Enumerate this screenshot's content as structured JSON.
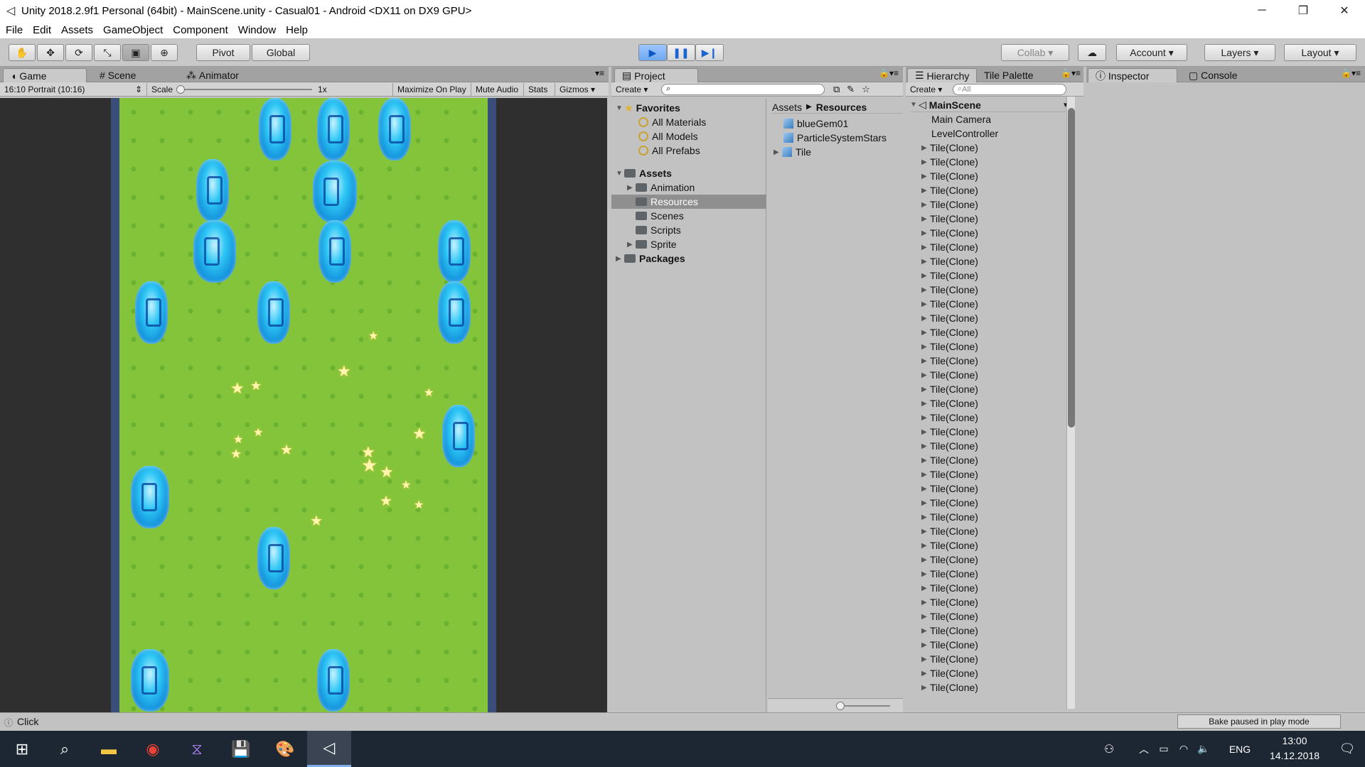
{
  "window": {
    "title": "Unity 2018.2.9f1 Personal (64bit) - MainScene.unity - Casual01 - Android <DX11 on DX9 GPU>",
    "minimize": "─",
    "restore": "❐",
    "close": "✕"
  },
  "menu": [
    "File",
    "Edit",
    "Assets",
    "GameObject",
    "Component",
    "Window",
    "Help"
  ],
  "toolbar": {
    "pivot": "Pivot",
    "global": "Global",
    "collab": "Collab",
    "account": "Account",
    "layers": "Layers",
    "layout": "Layout"
  },
  "game_panel": {
    "tabs": [
      "Game",
      "Scene",
      "Animator"
    ],
    "aspect": "16:10 Portrait (10:16)",
    "scale_label": "Scale",
    "scale_value": "1x",
    "maximize": "Maximize On Play",
    "mute": "Mute Audio",
    "stats": "Stats",
    "gizmos": "Gizmos"
  },
  "project_panel": {
    "tab": "Project",
    "create": "Create",
    "favorites": {
      "label": "Favorites",
      "items": [
        "All Materials",
        "All Models",
        "All Prefabs"
      ]
    },
    "assets": {
      "label": "Assets",
      "items": [
        "Animation",
        "Resources",
        "Scenes",
        "Scripts",
        "Sprite"
      ]
    },
    "packages": "Packages",
    "breadcrumb": [
      "Assets",
      "Resources"
    ],
    "files": [
      "blueGem01",
      "ParticleSystemStars",
      "Tile"
    ]
  },
  "hierarchy_panel": {
    "tabs": [
      "Hierarchy",
      "Tile Palette"
    ],
    "create": "Create",
    "search_placeholder": "All",
    "scene": "MainScene",
    "objects": [
      "Main Camera",
      "LevelController"
    ],
    "tile_label": "Tile(Clone)",
    "tile_count": 40
  },
  "inspector_panel": {
    "tabs": [
      "Inspector",
      "Console"
    ]
  },
  "status": {
    "message": "Click",
    "bake": "Bake paused in play mode"
  },
  "taskbar": {
    "language": "ENG",
    "time": "13:00",
    "date": "14.12.2018"
  }
}
